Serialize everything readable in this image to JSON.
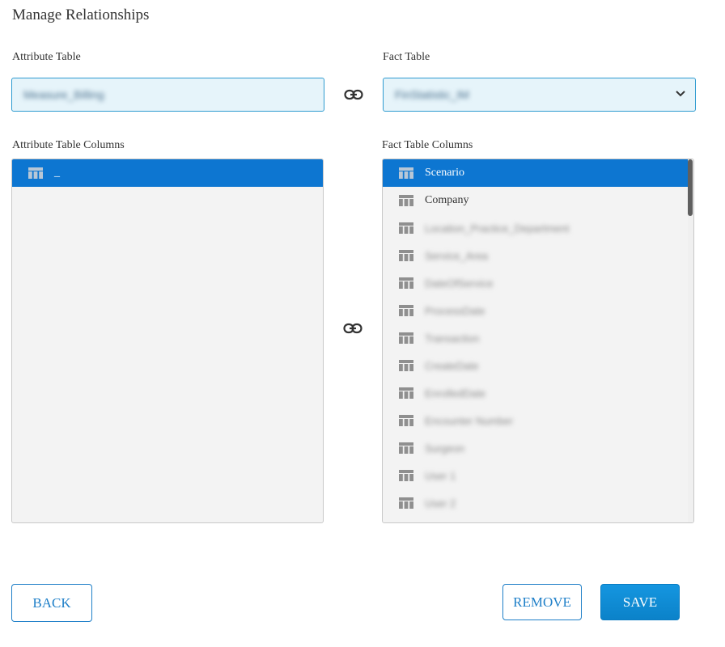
{
  "page": {
    "title": "Manage Relationships"
  },
  "attribute_table": {
    "label": "Attribute Table",
    "value": "Measure_Billing",
    "columns_label": "Attribute Table Columns",
    "columns": [
      {
        "label": "_",
        "selected": true,
        "blurred": false
      }
    ]
  },
  "fact_table": {
    "label": "Fact Table",
    "value": "FinStatistic_IM",
    "columns_label": "Fact Table Columns",
    "columns": [
      {
        "label": "Scenario",
        "selected": true,
        "blurred": false
      },
      {
        "label": "Company",
        "selected": false,
        "blurred": false
      },
      {
        "label": "Location_Practice_Department",
        "selected": false,
        "blurred": true
      },
      {
        "label": "Service_Area",
        "selected": false,
        "blurred": true
      },
      {
        "label": "DateOfService",
        "selected": false,
        "blurred": true
      },
      {
        "label": "ProcessDate",
        "selected": false,
        "blurred": true
      },
      {
        "label": "Transaction",
        "selected": false,
        "blurred": true
      },
      {
        "label": "CreateDate",
        "selected": false,
        "blurred": true
      },
      {
        "label": "EnrolledDate",
        "selected": false,
        "blurred": true
      },
      {
        "label": "Encounter Number",
        "selected": false,
        "blurred": true
      },
      {
        "label": "Surgeon",
        "selected": false,
        "blurred": true
      },
      {
        "label": "User 1",
        "selected": false,
        "blurred": true
      },
      {
        "label": "User 2",
        "selected": false,
        "blurred": true
      }
    ]
  },
  "icons": {
    "link": "link-icon",
    "column": "table-column-icon",
    "dropdown": "chevron-down-icon"
  },
  "buttons": {
    "back": "BACK",
    "remove": "REMOVE",
    "save": "SAVE"
  },
  "colors": {
    "accent": "#0d76d1",
    "field_bg": "#e6f4fa",
    "field_border": "#2e9bd0"
  }
}
